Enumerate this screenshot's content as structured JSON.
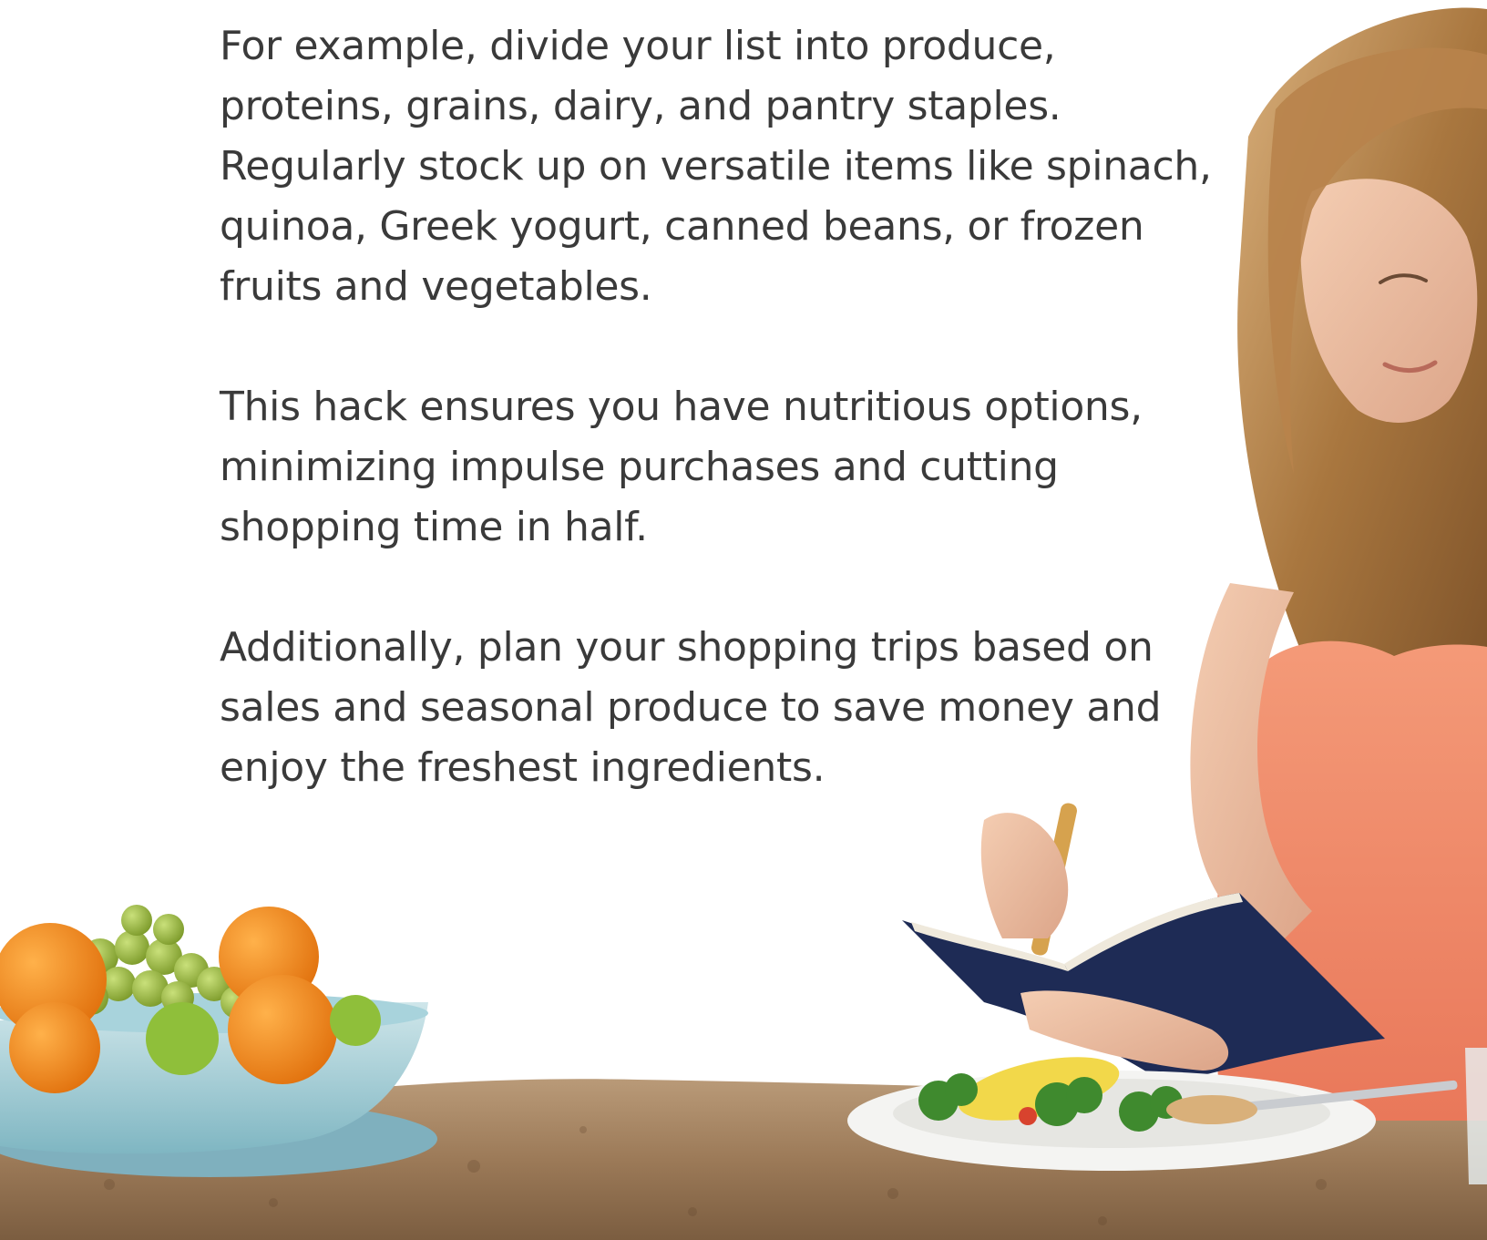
{
  "article": {
    "paragraphs": [
      "For example, divide your list into produce, proteins, grains, dairy, and pantry staples. Regularly stock up on versatile items like spinach, quinoa, Greek yogurt, canned beans, or frozen fruits and vegetables.",
      "This hack ensures you have nutritious options, minimizing impulse purchases and cutting shopping time in half.",
      "Additionally, plan your shopping trips based on sales and seasonal produce to save money and enjoy the freshest ingredients."
    ]
  },
  "colors": {
    "text": "#3a3a3a",
    "background": "#ffffff",
    "top": "#f08a66",
    "hair": "#b88856",
    "counter": "#a88462",
    "notebook": "#1e2b55"
  }
}
